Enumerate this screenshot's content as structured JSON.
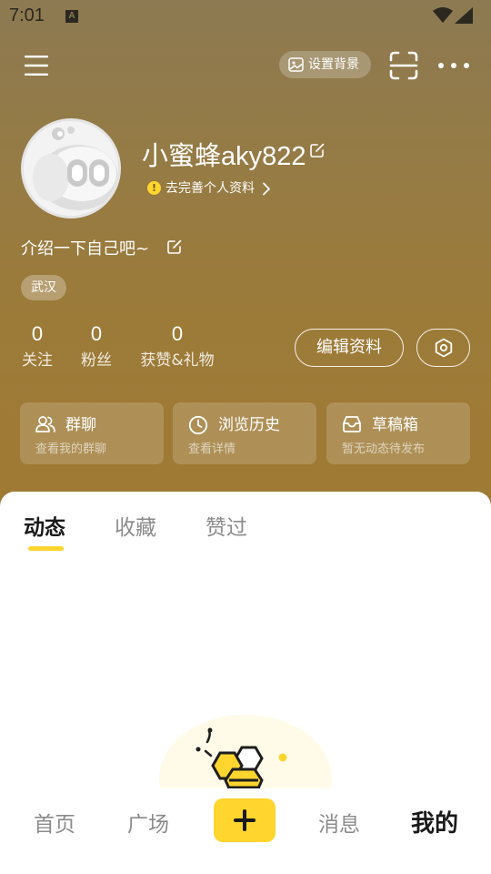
{
  "status_bar": {
    "time": "7:01",
    "notification_icon": "A"
  },
  "top_bar": {
    "menu_icon": "hamburger-icon",
    "set_background_label": "设置背景",
    "scan_icon": "scan-icon",
    "more_icon": "more-dots-icon"
  },
  "profile": {
    "username": "小蜜蜂aky822",
    "complete_profile_label": "去完善个人资料",
    "bio": "介绍一下自己吧~",
    "location": "武汉",
    "stats": [
      {
        "value": "0",
        "label": "关注"
      },
      {
        "value": "0",
        "label": "粉丝"
      },
      {
        "value": "0",
        "label": "获赞&礼物"
      }
    ],
    "edit_profile_label": "编辑资料"
  },
  "cards": [
    {
      "title": "群聊",
      "subtitle": "查看我的群聊",
      "icon": "group-icon"
    },
    {
      "title": "浏览历史",
      "subtitle": "查看详情",
      "icon": "clock-icon"
    },
    {
      "title": "草稿箱",
      "subtitle": "暂无动态待发布",
      "icon": "inbox-icon"
    }
  ],
  "tabs": [
    {
      "label": "动态",
      "active": true
    },
    {
      "label": "收藏",
      "active": false
    },
    {
      "label": "赞过",
      "active": false
    }
  ],
  "bottom_nav": [
    {
      "label": "首页",
      "active": false
    },
    {
      "label": "广场",
      "active": false
    },
    {
      "label": "消息",
      "active": false
    },
    {
      "label": "我的",
      "active": true
    }
  ],
  "colors": {
    "accent": "#ffd52e",
    "header_top": "#8d7a52",
    "header_bottom": "#a07a33"
  }
}
